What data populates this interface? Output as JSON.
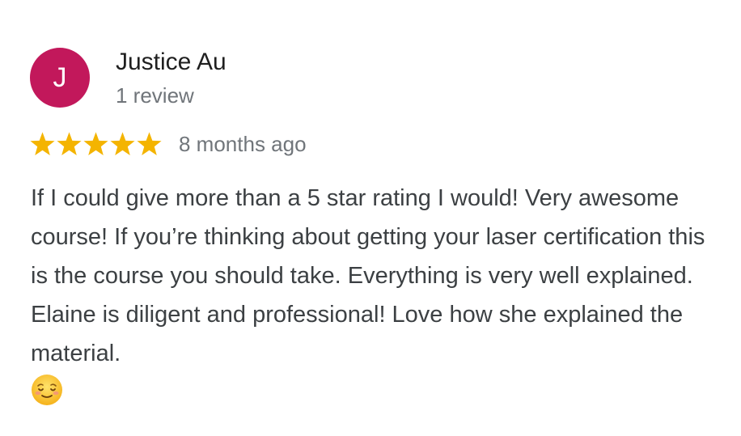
{
  "reviewer": {
    "avatar_initial": "J",
    "avatar_color": "#c2185b",
    "name": "Justice Au",
    "review_count": "1 review"
  },
  "review": {
    "rating": 5,
    "max_rating": 5,
    "star_color": "#f4b400",
    "time": "8 months ago",
    "text": "If I could give more than a 5 star rating I would! Very awesome course! If you’re thinking about getting your laser certification this is the course you should take. Everything is very well explained. Elaine is diligent and professional! Love how she explained the material.",
    "emoji": "smiling-face-icon"
  }
}
